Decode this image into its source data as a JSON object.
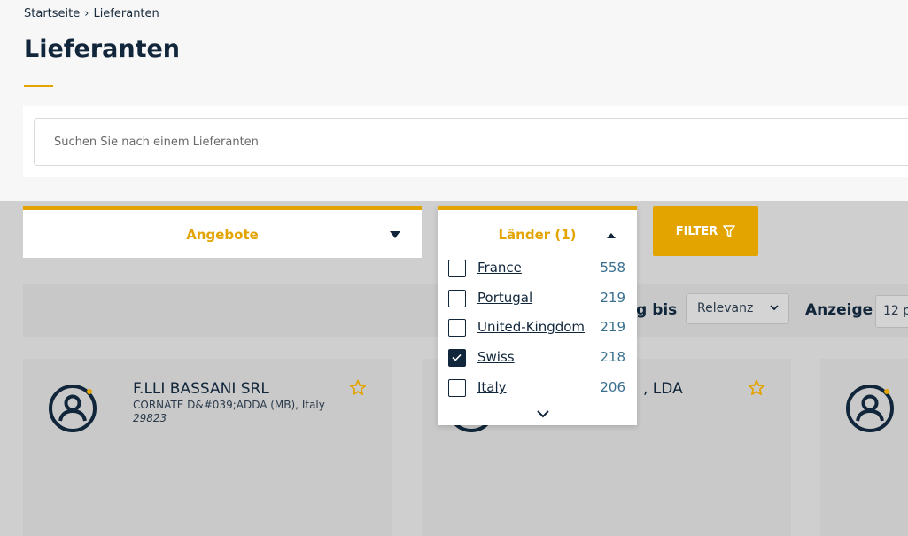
{
  "breadcrumb": {
    "home": "Startseite",
    "separator": "›",
    "current": "Lieferanten"
  },
  "page": {
    "title": "Lieferanten"
  },
  "search": {
    "placeholder": "Suchen Sie nach einem Lieferanten",
    "value": ""
  },
  "filters": {
    "offers_label": "Angebote",
    "countries_label": "Länder (1)",
    "filter_button": "FILTER"
  },
  "sorting": {
    "label_fragment": "ng bis",
    "value": "Relevanz",
    "show_label": "Anzeige",
    "show_value": "12 p"
  },
  "countries": [
    {
      "name": "France",
      "count": "558",
      "checked": false
    },
    {
      "name": "Portugal",
      "count": "219",
      "checked": false
    },
    {
      "name": "United-Kingdom",
      "count": "219",
      "checked": false
    },
    {
      "name": "Swiss",
      "count": "218",
      "checked": true
    },
    {
      "name": "Italy",
      "count": "206",
      "checked": false
    }
  ],
  "cards": [
    {
      "name": "F.LLI BASSANI SRL",
      "address": "CORNATE D&#039;ADDA (MB), Italy",
      "zip": "29823"
    },
    {
      "name": ", LDA"
    }
  ],
  "colors": {
    "accent": "#e3a400",
    "navy": "#11263a",
    "count_blue": "#3a6f8e"
  },
  "icons": {
    "avatar": "user-circle-icon",
    "favorite": "star-icon",
    "filter": "funnel-icon",
    "more": "chevron-down-icon"
  }
}
